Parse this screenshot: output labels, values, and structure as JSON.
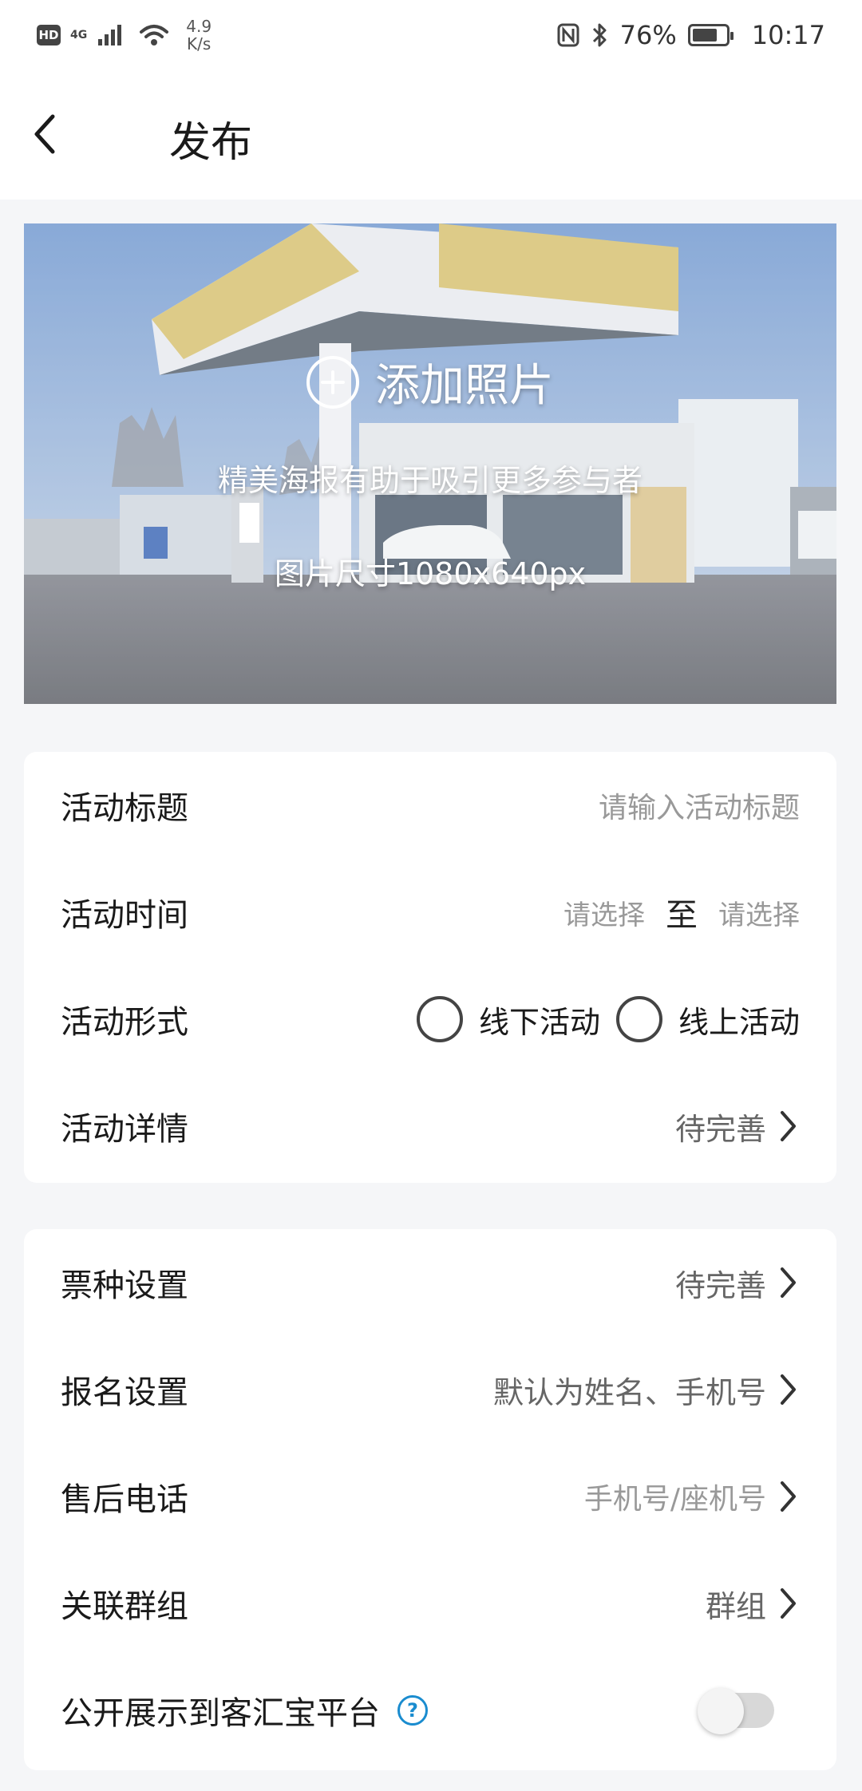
{
  "status_bar": {
    "hd": "HD",
    "network": "4G",
    "speed_value": "4.9",
    "speed_unit": "K/s",
    "battery": "76%",
    "battery_level": 0.76,
    "time": "10:17"
  },
  "header": {
    "title": "发布"
  },
  "cover": {
    "add_photo_label": "添加照片",
    "hint_line1": "精美海报有助于吸引更多参与者",
    "hint_line2": "图片尺寸1080x640px"
  },
  "basic_info": {
    "title_row": {
      "label": "活动标题",
      "placeholder": "请输入活动标题"
    },
    "time_row": {
      "label": "活动时间",
      "start_placeholder": "请选择",
      "separator": "至",
      "end_placeholder": "请选择"
    },
    "format_row": {
      "label": "活动形式",
      "option_offline": "线下活动",
      "option_online": "线上活动"
    },
    "detail_row": {
      "label": "活动详情",
      "value": "待完善"
    }
  },
  "settings": {
    "ticket_row": {
      "label": "票种设置",
      "value": "待完善"
    },
    "signup_row": {
      "label": "报名设置",
      "value": "默认为姓名、手机号"
    },
    "phone_row": {
      "label": "售后电话",
      "placeholder": "手机号/座机号"
    },
    "group_row": {
      "label": "关联群组",
      "value": "群组"
    },
    "public_row": {
      "label": "公开展示到客汇宝平台",
      "help": "?",
      "toggle_on": false
    }
  },
  "icons": {
    "back": "chevron-left-icon",
    "add": "plus-circle-icon",
    "arrow": "chevron-right-icon",
    "help": "question-circle-icon"
  },
  "colors": {
    "accent": "#1a8ccf",
    "placeholder": "#999999",
    "background": "#f5f6f8"
  }
}
